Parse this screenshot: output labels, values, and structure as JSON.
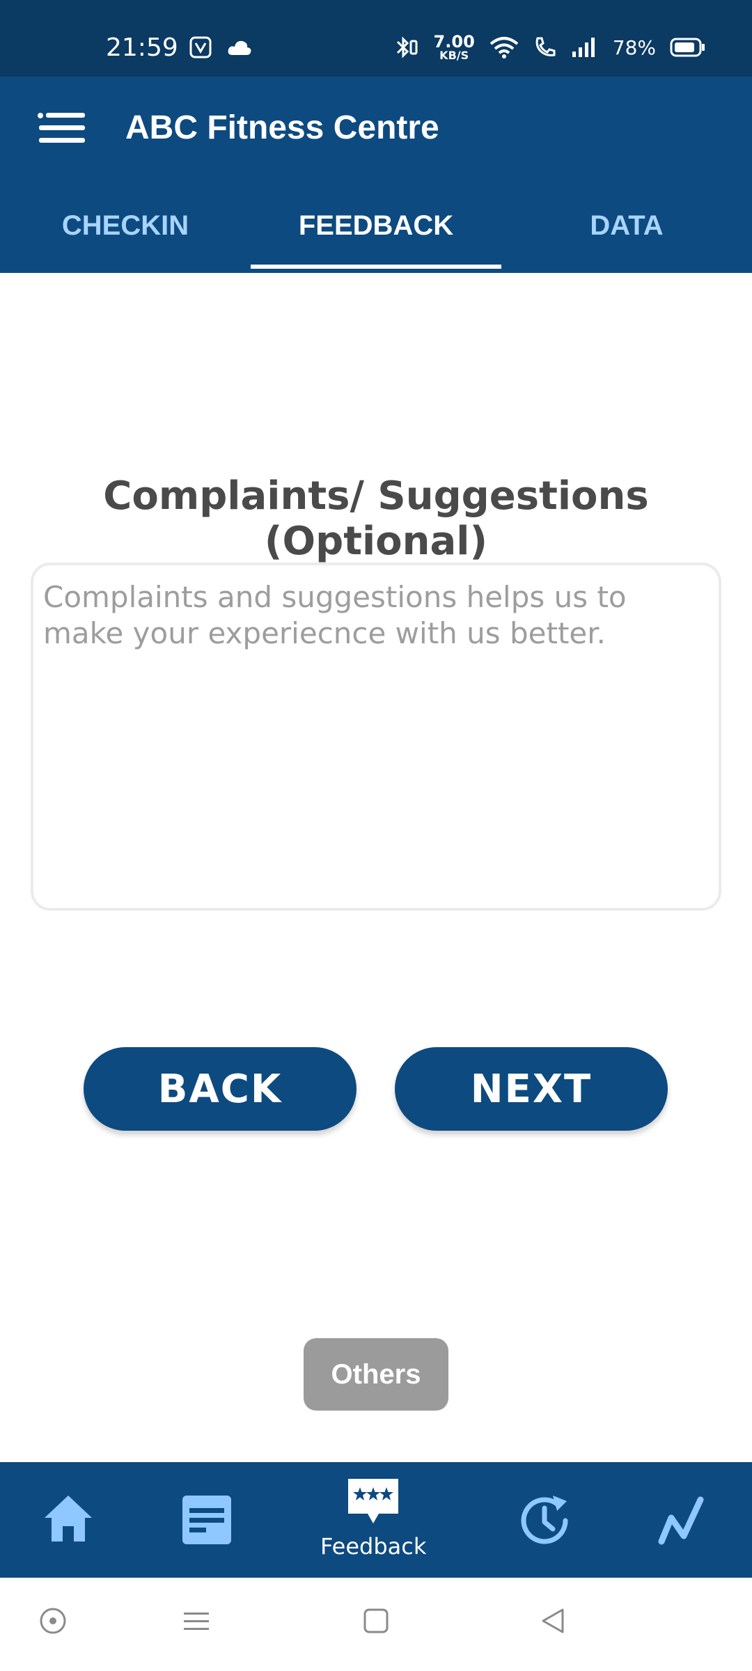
{
  "status_bar": {
    "time": "21:59",
    "net_speed_value": "7.00",
    "net_speed_unit": "KB/S",
    "battery_percent": "78%"
  },
  "app_bar": {
    "title": "ABC Fitness Centre",
    "menu_icon": "hamburger-menu-icon"
  },
  "tabs": [
    {
      "label": "CHECKIN",
      "active": false
    },
    {
      "label": "FEEDBACK",
      "active": true
    },
    {
      "label": "DATA",
      "active": false
    }
  ],
  "form": {
    "title": "Complaints/ Suggestions (Optional)",
    "textarea_value": "",
    "textarea_placeholder": "Complaints and suggestions helps us to make your experiecnce with us better."
  },
  "actions": {
    "back_label": "BACK",
    "next_label": "NEXT"
  },
  "chip": {
    "label": "Others"
  },
  "bottom_nav": {
    "items": [
      {
        "icon": "home-icon",
        "label": ""
      },
      {
        "icon": "notes-icon",
        "label": ""
      },
      {
        "icon": "feedback-icon",
        "label": "Feedback",
        "active": true
      },
      {
        "icon": "history-icon",
        "label": ""
      },
      {
        "icon": "stats-icon",
        "label": ""
      }
    ]
  },
  "colors": {
    "status_bar": "#0b3a63",
    "primary": "#0d4a80",
    "tab_inactive": "#a8d4ff",
    "nav_icon": "#8ec8ff",
    "chip": "#9b9b9b"
  }
}
